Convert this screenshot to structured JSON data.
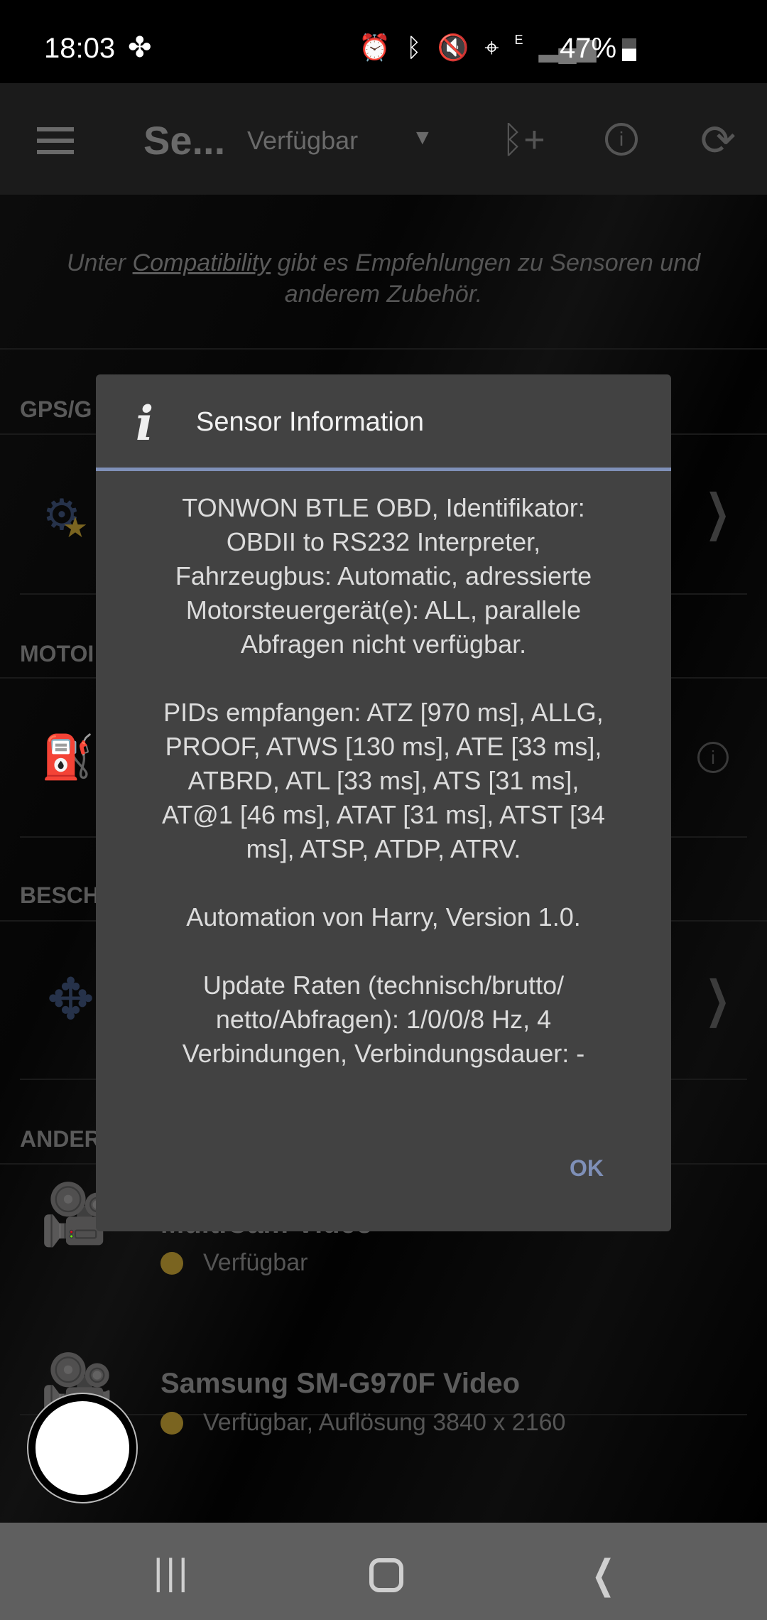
{
  "status_bar": {
    "time": "18:03",
    "battery": "47%",
    "network": "E",
    "icons": [
      "pinwheel-icon",
      "alarm-icon",
      "bluetooth-icon",
      "mute-icon",
      "location-icon",
      "signal-icon",
      "battery-icon"
    ]
  },
  "app_bar": {
    "title": "Se...",
    "filter": "Verfügbar",
    "icons": [
      "menu-icon",
      "dropdown-icon",
      "bluetooth-add-icon",
      "info-icon",
      "refresh-icon"
    ]
  },
  "hint": {
    "prefix": "Unter ",
    "link": "Compatibility",
    "suffix": " gibt es Empfehlungen zu Sensoren und anderem Zubehör."
  },
  "sections": [
    {
      "label": "GPS/G"
    },
    {
      "label": "MOTOI"
    },
    {
      "label": "BESCH"
    },
    {
      "label": "ANDER"
    }
  ],
  "devices": [
    {
      "title": "MultiCam Video",
      "status": "Verfügbar"
    },
    {
      "title": "Samsung SM-G970F Video",
      "status": "Verfügbar, Auflösung 3840 x 2160"
    }
  ],
  "dialog": {
    "title": "Sensor Information",
    "body": "TONWON BTLE OBD, Identifikator:\nOBDII to RS232 Interpreter,\nFahrzeugbus: Automatic, adressierte\nMotorsteuergerät(e): ALL, parallele\nAbfragen nicht verfügbar.\n\nPIDs empfangen: ATZ [970 ms], ALLG,\nPROOF, ATWS [130 ms], ATE [33 ms],\nATBRD, ATL [33 ms], ATS [31 ms],\nAT@1 [46 ms], ATAT [31 ms], ATST [34\nms], ATSP, ATDP, ATRV.\n\nAutomation von Harry, Version 1.0.\n\nUpdate Raten (technisch/brutto/\nnetto/Abfragen): 1/0/0/8 Hz, 4\nVerbindungen, Verbindungsdauer: -",
    "ok": "OK"
  },
  "colors": {
    "accent": "#7f90b8",
    "dialog_bg": "#424242",
    "status_dot": "#7a6420"
  }
}
